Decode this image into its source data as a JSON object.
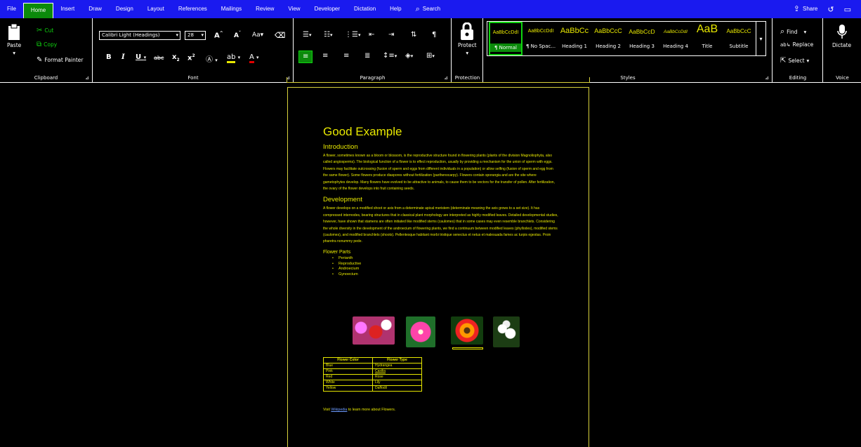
{
  "tabs": [
    "File",
    "Home",
    "Insert",
    "Draw",
    "Design",
    "Layout",
    "References",
    "Mailings",
    "Review",
    "View",
    "Developer",
    "Dictation",
    "Help"
  ],
  "active_tab": "Home",
  "search_label": "Search",
  "share_label": "Share",
  "clipboard": {
    "paste": "Paste",
    "cut": "Cut",
    "copy": "Copy",
    "format_painter": "Format Painter",
    "label": "Clipboard"
  },
  "font": {
    "name": "Calibri Light (Headings)",
    "size": "28",
    "change_case": "Aa",
    "label": "Font"
  },
  "paragraph": {
    "label": "Paragraph"
  },
  "protection": {
    "protect": "Protect",
    "label": "Protection"
  },
  "styles": {
    "label": "Styles",
    "items": [
      {
        "sample": "AaBbCcDdI",
        "name": "¶ Normal"
      },
      {
        "sample": "AaBbCcDdI",
        "name": "¶ No Spac..."
      },
      {
        "sample": "AaBbCc",
        "name": "Heading 1"
      },
      {
        "sample": "AaBbCcC",
        "name": "Heading 2"
      },
      {
        "sample": "AaBbCcD",
        "name": "Heading 3"
      },
      {
        "sample": "AaBbCcDdI",
        "name": "Heading 4"
      },
      {
        "sample": "AaB",
        "name": "Title"
      },
      {
        "sample": "AaBbCcC",
        "name": "Subtitle"
      }
    ]
  },
  "editing": {
    "find": "Find",
    "replace": "Replace",
    "select": "Select",
    "label": "Editing"
  },
  "voice": {
    "dictate": "Dictate",
    "label": "Voice"
  },
  "document": {
    "title": "Good Example",
    "intro_heading": "Introduction",
    "intro_text": "A flower, sometimes known as a bloom or blossom, is the reproductive structure found in flowering plants (plants of the division Magnoliophyta, also called angiosperms). The biological function of a flower is to effect reproduction, usually by providing a mechanism for the union of sperm with eggs. Flowers may facilitate outcrossing (fusion of sperm and eggs from different individuals in a population) or allow selfing (fusion of sperm and egg from the same flower). Some flowers produce diaspores without fertilization (parthenocarpy). Flowers contain sporangia and are the site where gametophytes develop. Many flowers have evolved to be attractive to animals, to cause them to be vectors for the transfer of pollen. After fertilization, the ovary of the flower develops into fruit containing seeds.",
    "dev_heading": "Development",
    "dev_text": "A flower develops on a modified shoot or axis from a determinate apical meristem (determinate meaning the axis grows to a set size). It has compressed internodes, bearing structures that in classical plant morphology are interpreted as highly modified leaves. Detailed developmental studies, however, have shown that stamens are often initiated like modified stems (caulomes) that in some cases may even resemble branchlets. Considering the whole diversity in the development of the androecium of flowering plants, we find a continuum between modified leaves (phyllodes), modified stems (caulomes), and modified branchlets (shoots). Pellentesque habitant morbi tristique senectus et netus et malesuada fames ac turpis egestas. Proin pharetra nonummy pede.",
    "parts_heading": "Flower Parts",
    "parts": [
      "Perianth",
      "Reproductive",
      "Androecium",
      "Gynoecium"
    ],
    "table_headers": [
      "Flower Color",
      "Flower Type"
    ],
    "table_rows": [
      [
        "Blue",
        "Hydrangea"
      ],
      [
        "Pink",
        "Casilia"
      ],
      [
        "Red",
        "Rose"
      ],
      [
        "White",
        "Lily"
      ],
      [
        "Yellow",
        "Daffodil"
      ]
    ],
    "visit_prefix": "Visit ",
    "visit_link": "Wikipedia",
    "visit_suffix": " to learn more about Flowers."
  },
  "colors": {
    "tabbar": "#1a1aef",
    "accent": "#0b8a0b",
    "doc_text": "#e8e800",
    "page_border": "#d7d13b"
  }
}
